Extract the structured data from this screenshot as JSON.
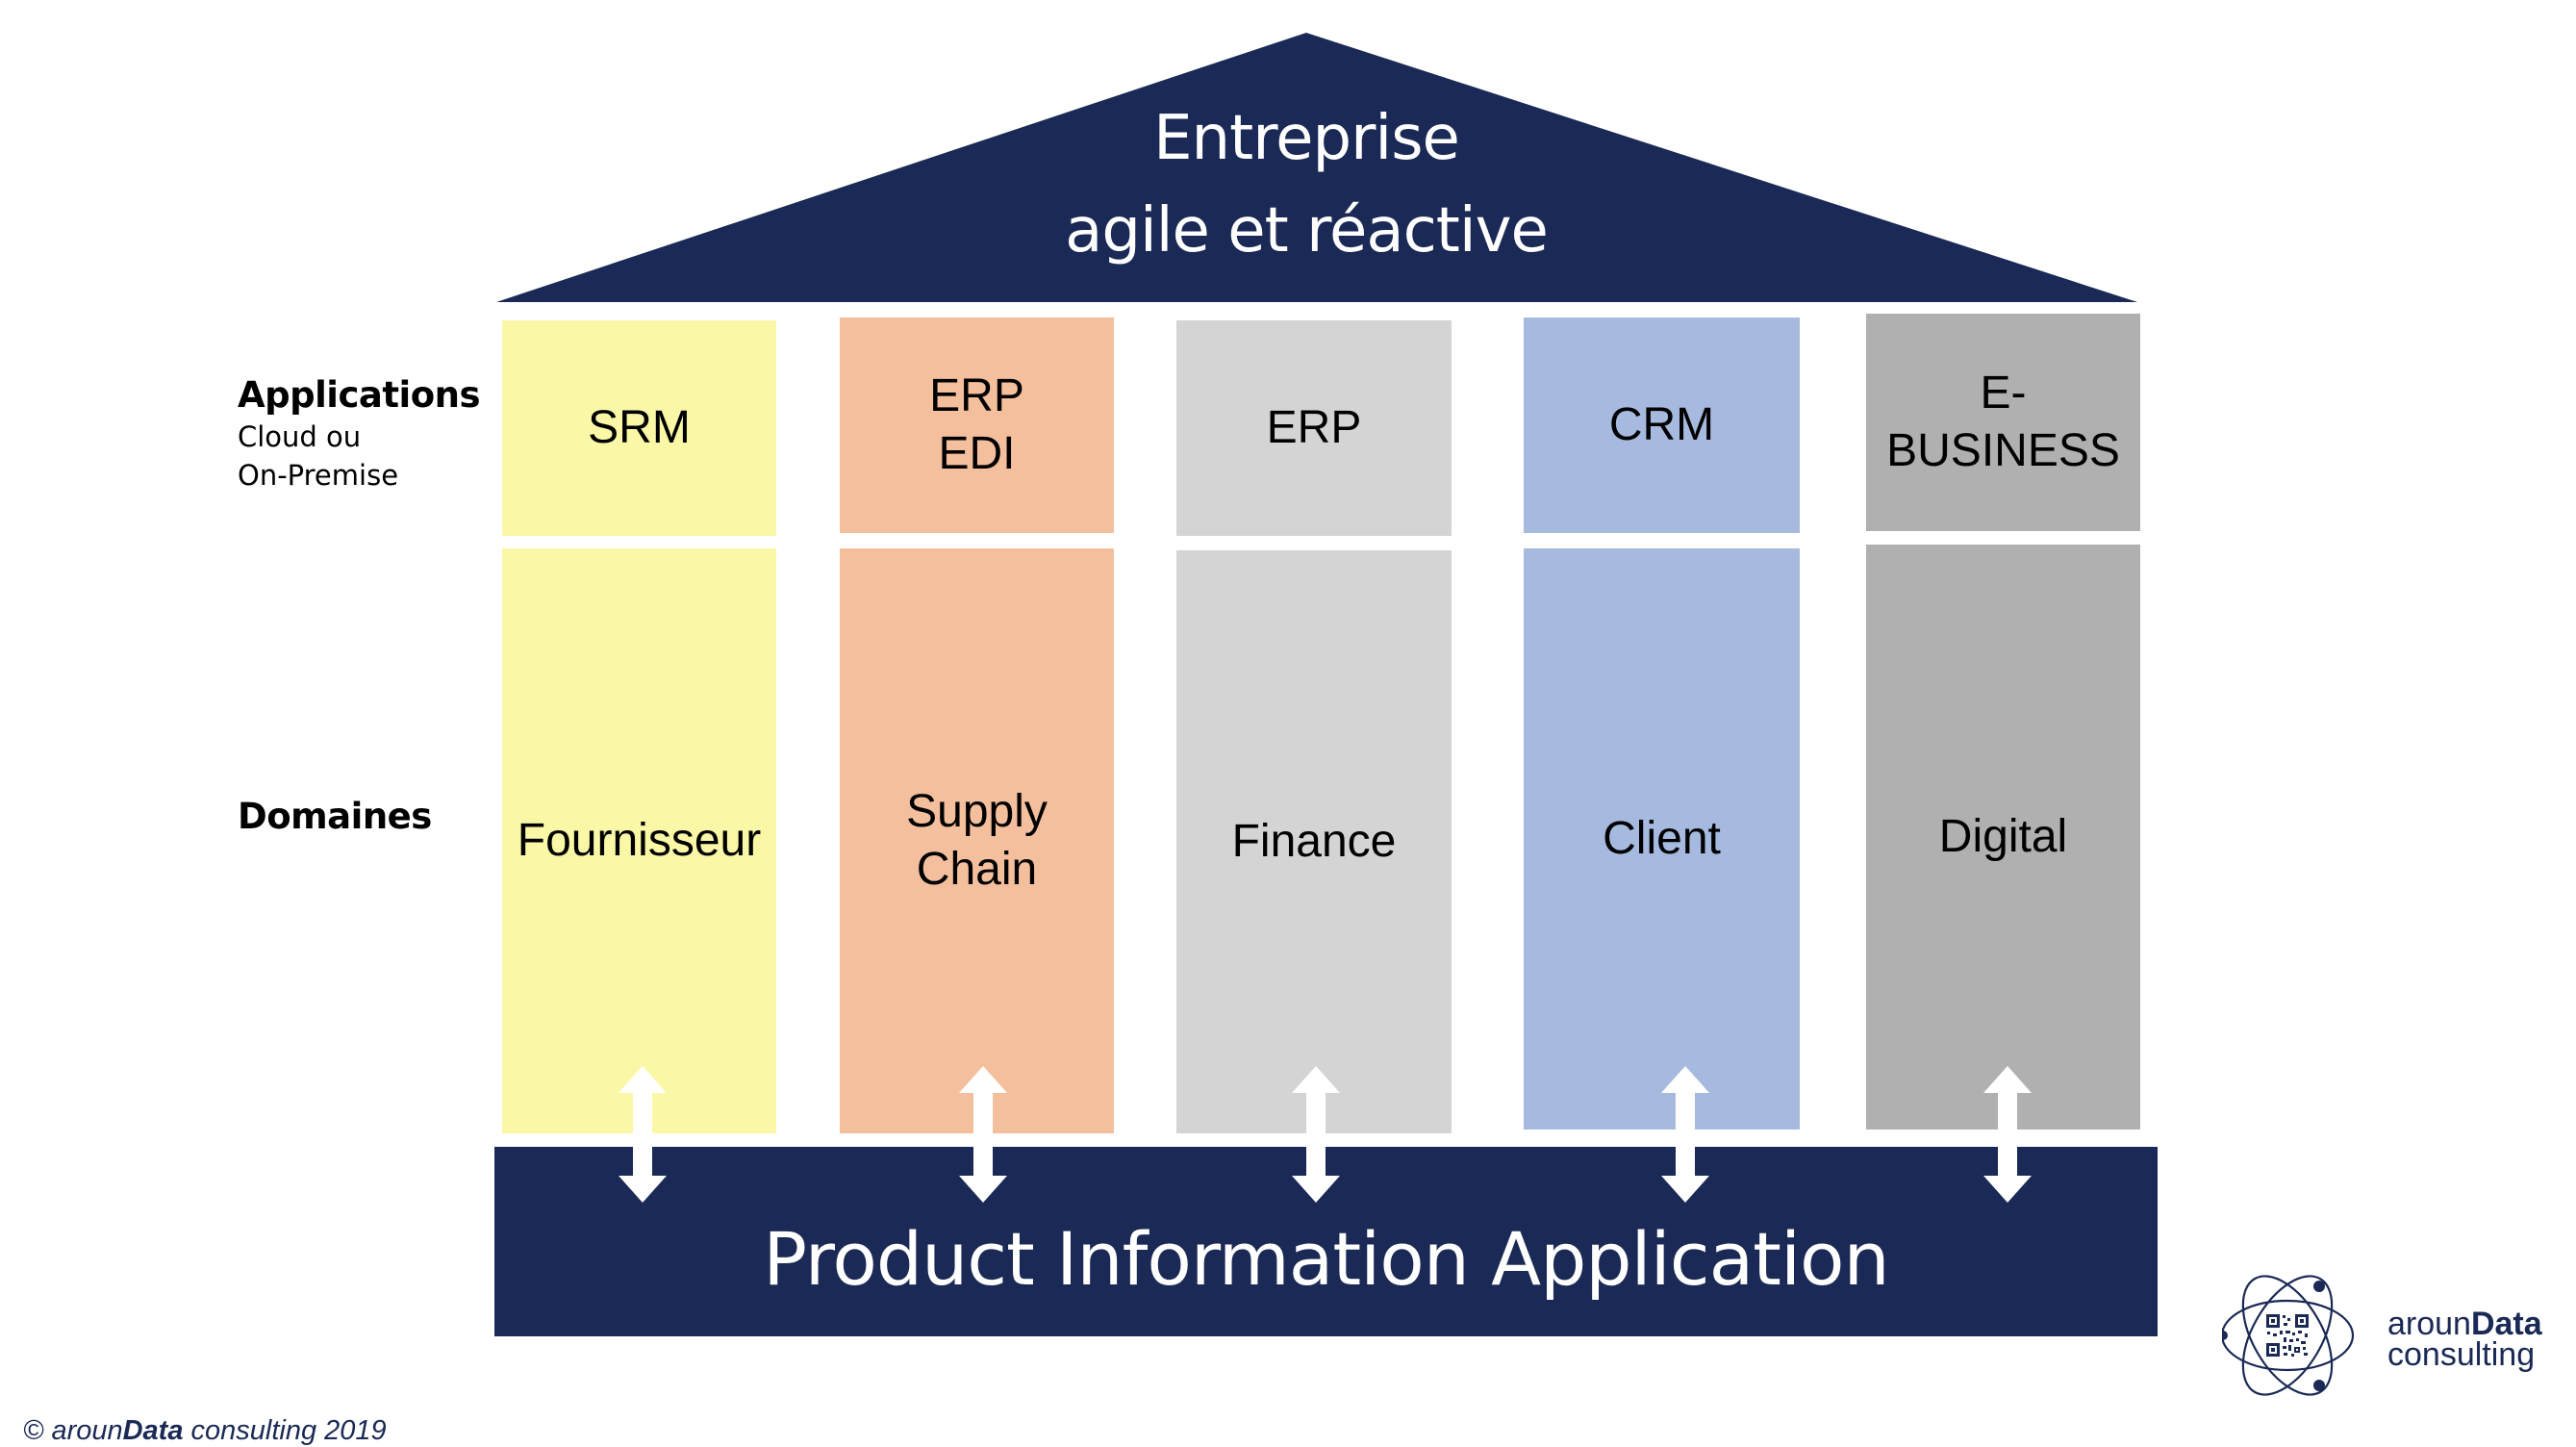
{
  "roof": {
    "title_line1": "Entreprise",
    "title_line2": "agile et réactive",
    "color": "#1a2955"
  },
  "row_labels": {
    "applications": {
      "title": "Applications",
      "sub_line1": "Cloud ou",
      "sub_line2": "On-Premise"
    },
    "domains": {
      "title": "Domaines"
    }
  },
  "pillars": [
    {
      "application": "SRM",
      "domain": "Fournisseur",
      "color": "#faf8a6"
    },
    {
      "application": "ERP\nEDI",
      "domain": "Supply\nChain",
      "color": "#f4bf9d"
    },
    {
      "application": "ERP",
      "domain": "Finance",
      "color": "#d4d4d4"
    },
    {
      "application": "CRM",
      "domain": "Client",
      "color": "#a6badf"
    },
    {
      "application": "E-\nBUSINESS",
      "domain": "Digital",
      "color": "#b0b0b0"
    }
  ],
  "foundation": {
    "label": "Product Information Application",
    "color": "#1a2955"
  },
  "arrow_icon": "bidirectional-vertical-arrow",
  "copyright": {
    "symbol": "©",
    "brand_prefix": "aroun",
    "brand_bold": "Data",
    "rest": " consulting 2019"
  },
  "logo": {
    "icon": "atom-qr-icon",
    "brand_prefix": "aroun",
    "brand_bold": "Data",
    "line2": "consulting"
  }
}
